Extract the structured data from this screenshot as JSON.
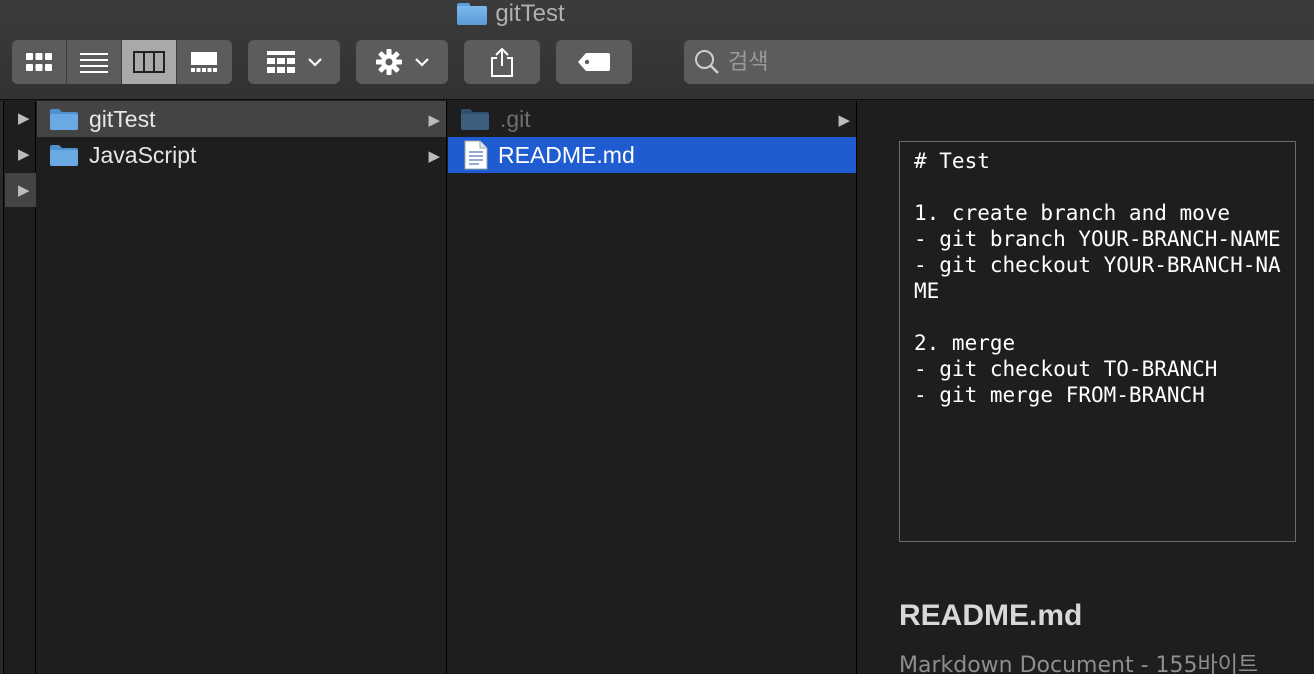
{
  "window": {
    "title": "gitTest"
  },
  "toolbar": {
    "view_modes": [
      {
        "name": "icon-view",
        "active": false
      },
      {
        "name": "list-view",
        "active": false
      },
      {
        "name": "column-view",
        "active": true
      },
      {
        "name": "gallery-view",
        "active": false
      }
    ],
    "search": {
      "placeholder": "검색",
      "value": ""
    }
  },
  "columns": {
    "col1": {
      "items": [
        {
          "label": "gitTest",
          "icon": "folder-icon",
          "selected": true,
          "has_children": true
        },
        {
          "label": "JavaScript",
          "icon": "folder-icon",
          "selected": false,
          "has_children": true
        }
      ]
    },
    "col2": {
      "items": [
        {
          "label": ".git",
          "icon": "folder-icon",
          "hidden": true,
          "has_children": true
        },
        {
          "label": "README.md",
          "icon": "document-icon",
          "selected": true
        }
      ]
    }
  },
  "preview": {
    "content": "# Test\n\n1. create branch and move\n- git branch YOUR-BRANCH-NAME\n- git checkout YOUR-BRANCH-NAME\n\n2. merge\n- git checkout TO-BRANCH\n- git merge FROM-BRANCH",
    "filename": "README.md",
    "kind": "Markdown Document - 155바이트"
  },
  "colors": {
    "selection": "#1f5cd1",
    "folder": "#6aa9e3",
    "background": "#1e1e1e"
  }
}
